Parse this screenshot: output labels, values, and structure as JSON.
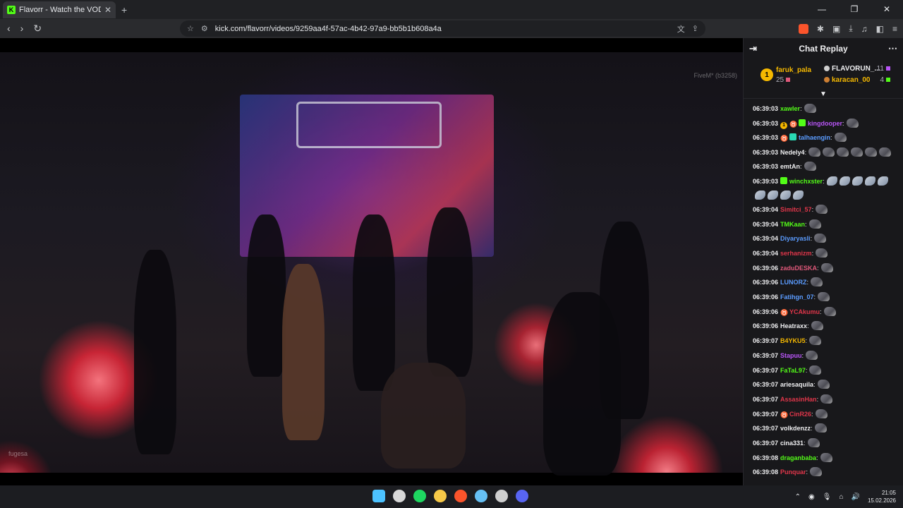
{
  "browser": {
    "tab_title": "Flavorr - Watch the VOD on Kick",
    "tab_close": "✕",
    "new_tab": "+",
    "window_controls": [
      "—",
      "❐",
      "✕"
    ],
    "nav_back": "‹",
    "nav_forward": "›",
    "nav_reload": "↻",
    "url": "kick.com/flavorr/videos/9259aa4f-57ac-4b42-97a9-bb5b1b608a4a",
    "brand_color": "#53fc18"
  },
  "video": {
    "watermark": "FiveM* (b3258)",
    "player_tag": "fugesa"
  },
  "chat": {
    "title": "Chat Replay",
    "leaderboard": {
      "first": {
        "rank": "1",
        "name": "faruk_pala",
        "count": "25"
      },
      "second": {
        "name": "FLAVORUN_...",
        "count": "11"
      },
      "third": {
        "name": "karacan_00",
        "count": "4"
      }
    },
    "messages": [
      {
        "time": "06:39:03",
        "user": "xawler",
        "color": "#53fc18",
        "emotes": 1,
        "badges": []
      },
      {
        "time": "06:39:03",
        "user": "kingdooper",
        "color": "#b855f7",
        "emotes": 1,
        "badges": [
          "coin",
          "horn",
          "sub"
        ]
      },
      {
        "time": "06:39:03",
        "user": "talhaengin",
        "color": "#5b9cff",
        "emotes": 1,
        "badges": [
          "horn",
          "tealsub"
        ]
      },
      {
        "time": "06:39:03",
        "user": "Nedely4",
        "color": "#efeff1",
        "emotes": 6,
        "badges": [],
        "wrap": true
      },
      {
        "time": "06:39:03",
        "user": "emtAn",
        "color": "#efeff1",
        "emotes": 1,
        "badges": []
      },
      {
        "time": "06:39:03",
        "user": "winchxster",
        "color": "#53fc18",
        "emotes": 9,
        "fish": true,
        "badges": [
          "sub"
        ],
        "wrap": true
      },
      {
        "time": "06:39:04",
        "user": "Simitci_57",
        "color": "#e0364a",
        "emotes": 1,
        "badges": []
      },
      {
        "time": "06:39:04",
        "user": "TMKaan",
        "color": "#53fc18",
        "emotes": 1,
        "badges": []
      },
      {
        "time": "06:39:04",
        "user": "Diyaryasli",
        "color": "#5b9cff",
        "emotes": 1,
        "badges": []
      },
      {
        "time": "06:39:04",
        "user": "serhanizm",
        "color": "#e0364a",
        "emotes": 1,
        "badges": []
      },
      {
        "time": "06:39:06",
        "user": "zaduDESKA",
        "color": "#e0587a",
        "emotes": 1,
        "badges": []
      },
      {
        "time": "06:39:06",
        "user": "LUNORZ",
        "color": "#5b9cff",
        "emotes": 1,
        "badges": []
      },
      {
        "time": "06:39:06",
        "user": "Fatihgn_07",
        "color": "#5b9cff",
        "emotes": 1,
        "badges": []
      },
      {
        "time": "06:39:06",
        "user": "YCAkumu",
        "color": "#e0364a",
        "emotes": 1,
        "badges": [
          "horn"
        ]
      },
      {
        "time": "06:39:06",
        "user": "Heatraxx",
        "color": "#efeff1",
        "emotes": 1,
        "badges": []
      },
      {
        "time": "06:39:07",
        "user": "B4YKU5",
        "color": "#f5b800",
        "emotes": 1,
        "badges": []
      },
      {
        "time": "06:39:07",
        "user": "Stapuu",
        "color": "#b855f7",
        "emotes": 1,
        "badges": []
      },
      {
        "time": "06:39:07",
        "user": "FaTaL97",
        "color": "#53fc18",
        "emotes": 1,
        "badges": []
      },
      {
        "time": "06:39:07",
        "user": "ariesaquila",
        "color": "#efeff1",
        "emotes": 1,
        "badges": []
      },
      {
        "time": "06:39:07",
        "user": "AssasinHan",
        "color": "#e0364a",
        "emotes": 1,
        "badges": []
      },
      {
        "time": "06:39:07",
        "user": "CinR26",
        "color": "#e0364a",
        "emotes": 1,
        "badges": [
          "horn"
        ]
      },
      {
        "time": "06:39:07",
        "user": "volkdenzz",
        "color": "#efeff1",
        "emotes": 1,
        "badges": []
      },
      {
        "time": "06:39:07",
        "user": "cina331",
        "color": "#efeff1",
        "emotes": 1,
        "badges": []
      },
      {
        "time": "06:39:08",
        "user": "draganbaba",
        "color": "#53fc18",
        "emotes": 1,
        "badges": []
      },
      {
        "time": "06:39:08",
        "user": "Punquar",
        "color": "#e0364a",
        "emotes": 1,
        "badges": []
      }
    ]
  },
  "taskbar": {
    "time": "21:05",
    "date": "15.02.2026",
    "app_colors": [
      "#4cc2ff",
      "#d8d8d8",
      "#1ed760",
      "#f7c948",
      "#fb542b",
      "#66c0f4",
      "#cfcfcf",
      "#5865f2"
    ]
  }
}
